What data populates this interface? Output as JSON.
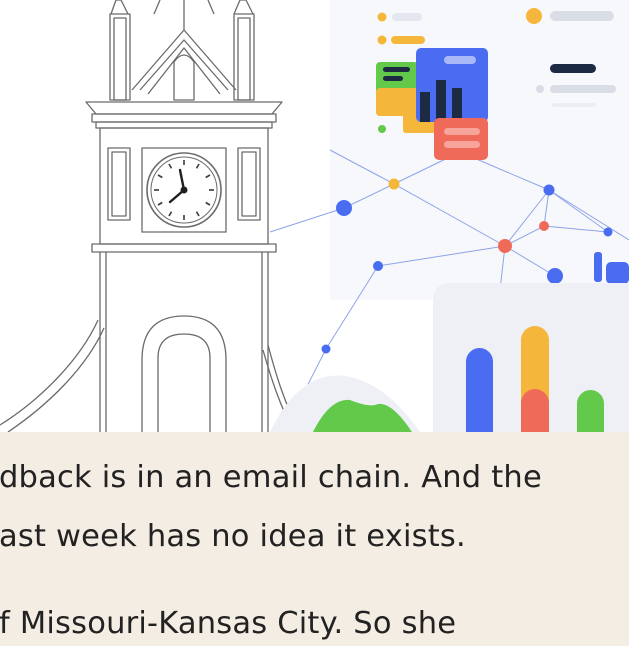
{
  "article": {
    "lines": [
      "dback is in an email chain. And the",
      "ast week has no idea it exists.",
      "f Missouri-Kansas City. So she"
    ]
  },
  "colors": {
    "background": "#ffffff",
    "text_panel": "#f4ede3",
    "text": "#222222",
    "tower_stroke": "#6b6b6b",
    "accent_blue": "#4a6cf0",
    "accent_yellow": "#f5b73b",
    "accent_red": "#f06a5a",
    "accent_green": "#63c94a",
    "accent_navy": "#1d2a44",
    "muted_gray": "#d9dde6"
  },
  "illustration": {
    "left_icon": "clock-tower-icon",
    "right_icon": "network-dashboard-icon"
  }
}
